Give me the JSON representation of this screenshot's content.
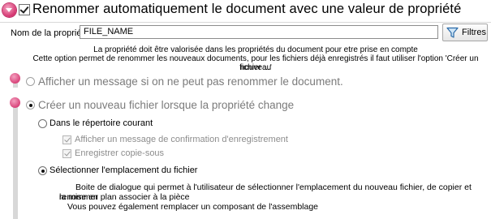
{
  "header": {
    "title": "Renommer automatiquement le document avec une valeur de propriété",
    "enabled": true
  },
  "property": {
    "label": "Nom de la propriété:",
    "value": "FILE_NAME",
    "filter_button": "Filtres"
  },
  "info_lines": [
    "La propriété doit être valorisée dans les propriétés du document pour etre prise en compte",
    "Cette option permet de renommer les nouveaux documents, pour les fichiers déjà enregistrés il faut utiliser l'option 'Créer un nouveau",
    "fichier ...'"
  ],
  "options": {
    "show_message": {
      "label": "Afficher un message si on ne peut pas renommer le document.",
      "selected": false
    },
    "create_new": {
      "label": "Créer un nouveau fichier lorsque la propriété change",
      "selected": true,
      "sub": {
        "current_dir": {
          "label": "Dans le répertoire courant",
          "selected": false,
          "checks": [
            {
              "label": "Afficher un message de confirmation d'enregistrement",
              "checked": true
            },
            {
              "label": "Enregistrer copie-sous",
              "checked": true
            }
          ]
        },
        "select_location": {
          "label": "Sélectionner l'emplacement du fichier",
          "selected": true,
          "description": [
            "Boite de dialogue qui permet à l'utilisateur de sélectionner l'emplacement du nouveau fichier, de copier et renommer",
            "la mise en plan associer à la pièce",
            "Vous pouvez également remplacer un composant de l'assemblage"
          ]
        }
      }
    }
  },
  "colors": {
    "accent": "#d4346f",
    "rail": "#d8d8d8",
    "disabled_text": "#8d8d8d"
  }
}
